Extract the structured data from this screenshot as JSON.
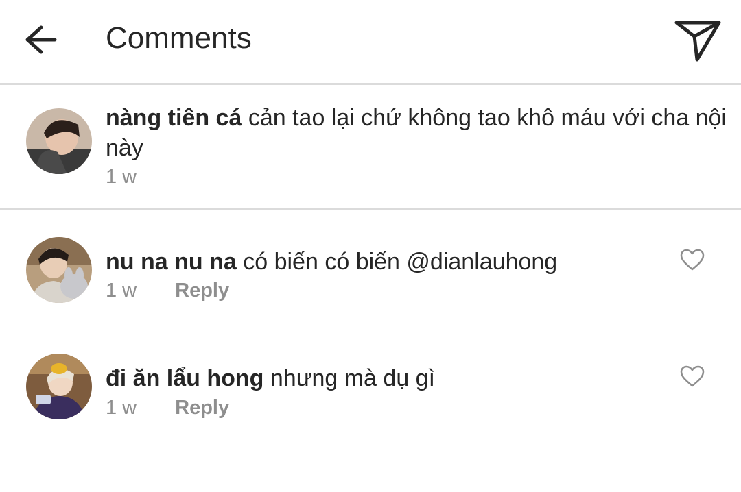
{
  "header": {
    "title": "Comments",
    "back_icon": "arrow-left-icon",
    "share_icon": "paper-plane-icon"
  },
  "caption": {
    "username": "nàng tiên cá",
    "text": "cản tao lại chứ không tao khô máu với cha nội này",
    "time": "1 w"
  },
  "comments": [
    {
      "username": "nu na nu na",
      "text": "có biến có biến @dianlauhong",
      "time": "1 w",
      "reply_label": "Reply",
      "like_icon": "heart-outline-icon"
    },
    {
      "username": "đi ăn lẩu hong",
      "text": "nhưng mà dụ gì",
      "time": "1 w",
      "reply_label": "Reply",
      "like_icon": "heart-outline-icon"
    }
  ],
  "colors": {
    "text_primary": "#262626",
    "text_secondary": "#8e8e8e",
    "divider": "#dbdbdb",
    "background": "#ffffff"
  }
}
